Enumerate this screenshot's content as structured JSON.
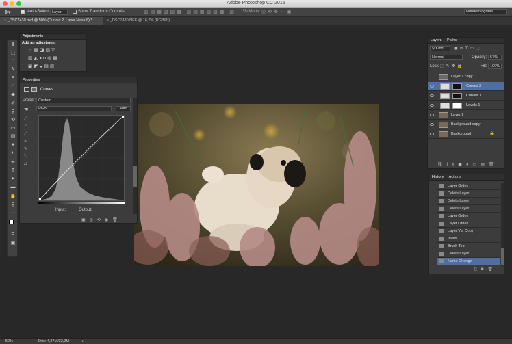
{
  "app": {
    "title": "Adobe Photoshop CC 2015"
  },
  "options_bar": {
    "auto_select_label": "Auto-Select:",
    "auto_select_value": "Layer",
    "transform_label": "Show Transform Controls",
    "mode_3d": "3D Mode:",
    "workspace": "Hundefotografie"
  },
  "doc_tabs": [
    {
      "label": "_DSC7430.psd @ 50% (Curves 2, Layer Mask/8) *"
    },
    {
      "label": "_DSC7430.NEF @ 16,7% (RGB/8*)"
    }
  ],
  "adjustments": {
    "title": "Adjustments",
    "subtitle": "Add an adjustment"
  },
  "properties": {
    "title": "Properties",
    "adj_name": "Curves",
    "preset_label": "Preset:",
    "preset_value": "Custom",
    "channel_value": "RGB",
    "auto_label": "Auto",
    "input_label": "Input:",
    "output_label": "Output:"
  },
  "layers_panel": {
    "tabs": [
      "Layers",
      "Paths"
    ],
    "kind_value": "Kind",
    "blend_mode": "Normal",
    "opacity_label": "Opacity:",
    "opacity_value": "57%",
    "lock_label": "Lock:",
    "fill_label": "Fill:",
    "fill_value": "100%",
    "layers": [
      {
        "name": "Layer 1 copy"
      },
      {
        "name": "Curves 2"
      },
      {
        "name": "Curves 1"
      },
      {
        "name": "Levels 1"
      },
      {
        "name": "Layer 1"
      },
      {
        "name": "Background copy"
      },
      {
        "name": "Background"
      }
    ]
  },
  "history_panel": {
    "tabs": [
      "History",
      "Actions"
    ],
    "items": [
      {
        "label": "Layer Order"
      },
      {
        "label": "Delete Layer"
      },
      {
        "label": "Delete Layer"
      },
      {
        "label": "Delete Layer"
      },
      {
        "label": "Layer Order"
      },
      {
        "label": "Layer Order"
      },
      {
        "label": "Layer Via Copy"
      },
      {
        "label": "Invert"
      },
      {
        "label": "Brush Tool"
      },
      {
        "label": "Delete Layer"
      },
      {
        "label": "Name Change"
      }
    ]
  },
  "status": {
    "zoom": "50%",
    "doc": "Doc: 4,27M/33,9M"
  },
  "colors": {
    "selection": "#4d6fa1",
    "ui_bg": "#282828"
  }
}
